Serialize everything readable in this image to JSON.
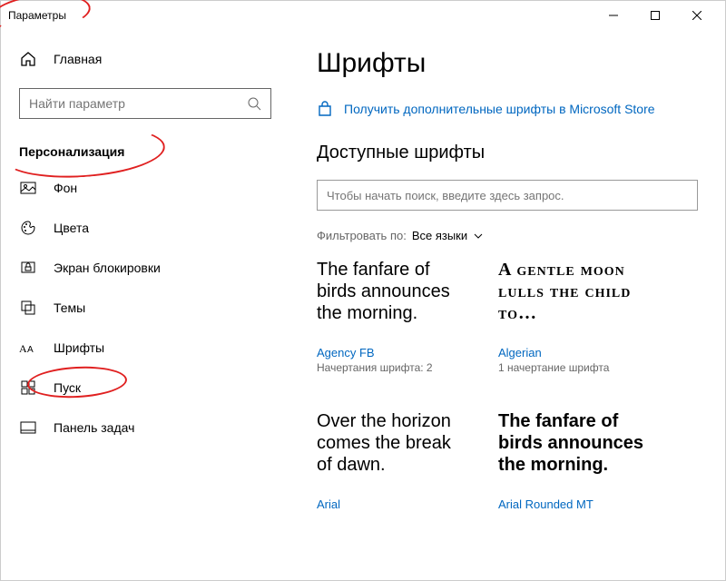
{
  "window": {
    "title": "Параметры"
  },
  "sidebar": {
    "home": "Главная",
    "search_placeholder": "Найти параметр",
    "section": "Персонализация",
    "items": [
      {
        "label": "Фон"
      },
      {
        "label": "Цвета"
      },
      {
        "label": "Экран блокировки"
      },
      {
        "label": "Темы"
      },
      {
        "label": "Шрифты"
      },
      {
        "label": "Пуск"
      },
      {
        "label": "Панель задач"
      }
    ]
  },
  "main": {
    "heading": "Шрифты",
    "store_link": "Получить дополнительные шрифты в Microsoft Store",
    "available": "Доступные шрифты",
    "font_search_placeholder": "Чтобы начать поиск, введите здесь запрос.",
    "filter_label": "Фильтровать по:",
    "filter_value": "Все языки",
    "fonts": [
      {
        "preview": "The fanfare of birds announces the morning.",
        "name": "Agency FB",
        "meta": "Начертания шрифта: 2"
      },
      {
        "preview": "A gentle moon lulls the child to…",
        "name": "Algerian",
        "meta": "1 начертание шрифта"
      },
      {
        "preview": "Over the horizon comes the break of dawn.",
        "name": "Arial",
        "meta": ""
      },
      {
        "preview": "The fanfare of birds announces the morning.",
        "name": "Arial Rounded MT",
        "meta": ""
      }
    ]
  }
}
